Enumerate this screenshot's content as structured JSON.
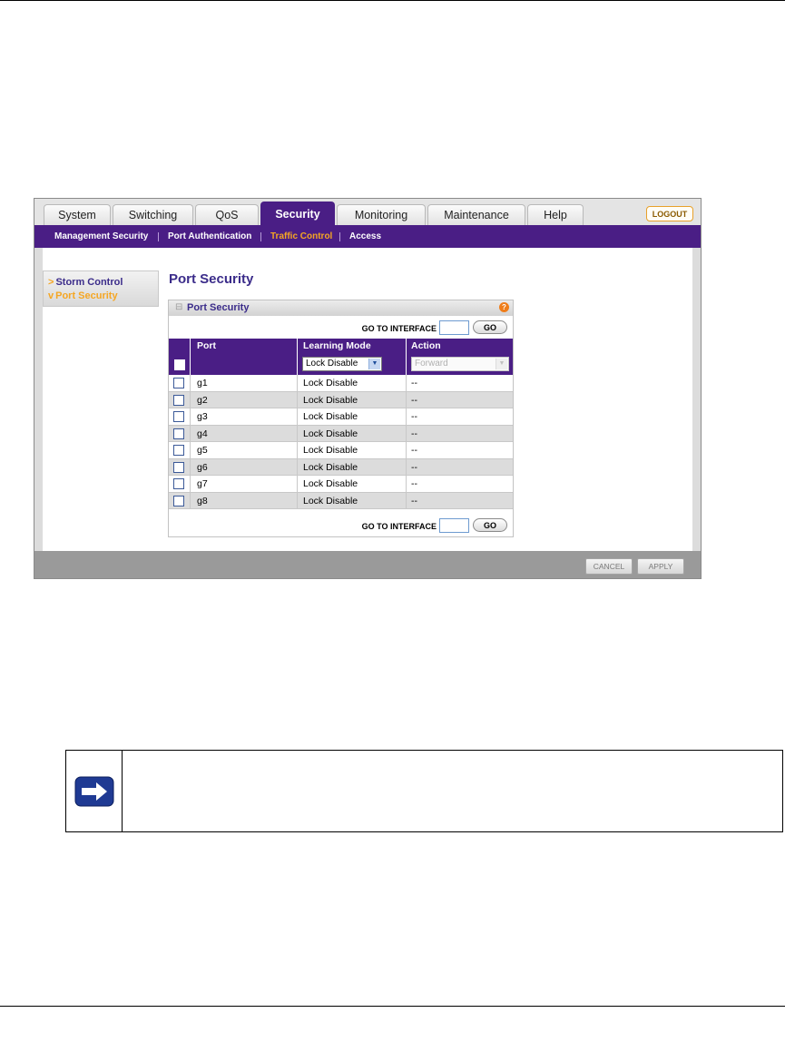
{
  "tabs": [
    {
      "label": "System",
      "active": false
    },
    {
      "label": "Switching",
      "active": false
    },
    {
      "label": "QoS",
      "active": false
    },
    {
      "label": "Security",
      "active": true
    },
    {
      "label": "Monitoring",
      "active": false
    },
    {
      "label": "Maintenance",
      "active": false
    },
    {
      "label": "Help",
      "active": false
    }
  ],
  "logout_label": "LOGOUT",
  "subnav": [
    {
      "label": "Management Security",
      "active": false
    },
    {
      "label": "Port Authentication",
      "active": false
    },
    {
      "label": "Traffic Control",
      "active": true
    },
    {
      "label": "Access",
      "active": false
    }
  ],
  "leftnav": {
    "items": [
      {
        "label": "Storm Control",
        "arrow": ">"
      },
      {
        "label": "Port Security",
        "arrow": "v"
      }
    ]
  },
  "page_title": "Port Security",
  "panel": {
    "title": "Port Security",
    "collapse_glyph": "⊟",
    "help_glyph": "?",
    "goto_label": "GO TO INTERFACE",
    "go_label": "GO",
    "columns": [
      "Port",
      "Learning Mode",
      "Action"
    ],
    "control_row": {
      "learning_mode": "Lock Disable",
      "action": "Forward"
    },
    "rows": [
      {
        "port": "g1",
        "mode": "Lock Disable",
        "action": "--"
      },
      {
        "port": "g2",
        "mode": "Lock Disable",
        "action": "--"
      },
      {
        "port": "g3",
        "mode": "Lock Disable",
        "action": "--"
      },
      {
        "port": "g4",
        "mode": "Lock Disable",
        "action": "--"
      },
      {
        "port": "g5",
        "mode": "Lock Disable",
        "action": "--"
      },
      {
        "port": "g6",
        "mode": "Lock Disable",
        "action": "--"
      },
      {
        "port": "g7",
        "mode": "Lock Disable",
        "action": "--"
      },
      {
        "port": "g8",
        "mode": "Lock Disable",
        "action": "--"
      }
    ]
  },
  "footer": {
    "cancel_label": "CANCEL",
    "apply_label": "APPLY"
  },
  "colors": {
    "accent_purple": "#4a1e85",
    "highlight_orange": "#f5a623",
    "note_icon_blue": "#1f3a93"
  },
  "icons": {
    "note": "right-arrow-icon"
  }
}
